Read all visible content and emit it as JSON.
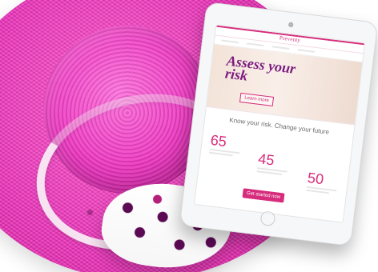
{
  "tablet": {
    "brand": "Preventy",
    "hero": {
      "title_lines": [
        "Assess your",
        "risk"
      ],
      "button_label": "Learn more"
    },
    "section_title": "Know your risk. Change your future",
    "stats": [
      "65",
      "45",
      "50"
    ],
    "cta_label": "Get started now"
  },
  "colors": {
    "hat_pink": "#ec2fb9",
    "accent_pink": "#d72c7c",
    "purple": "#7b1b7f"
  }
}
